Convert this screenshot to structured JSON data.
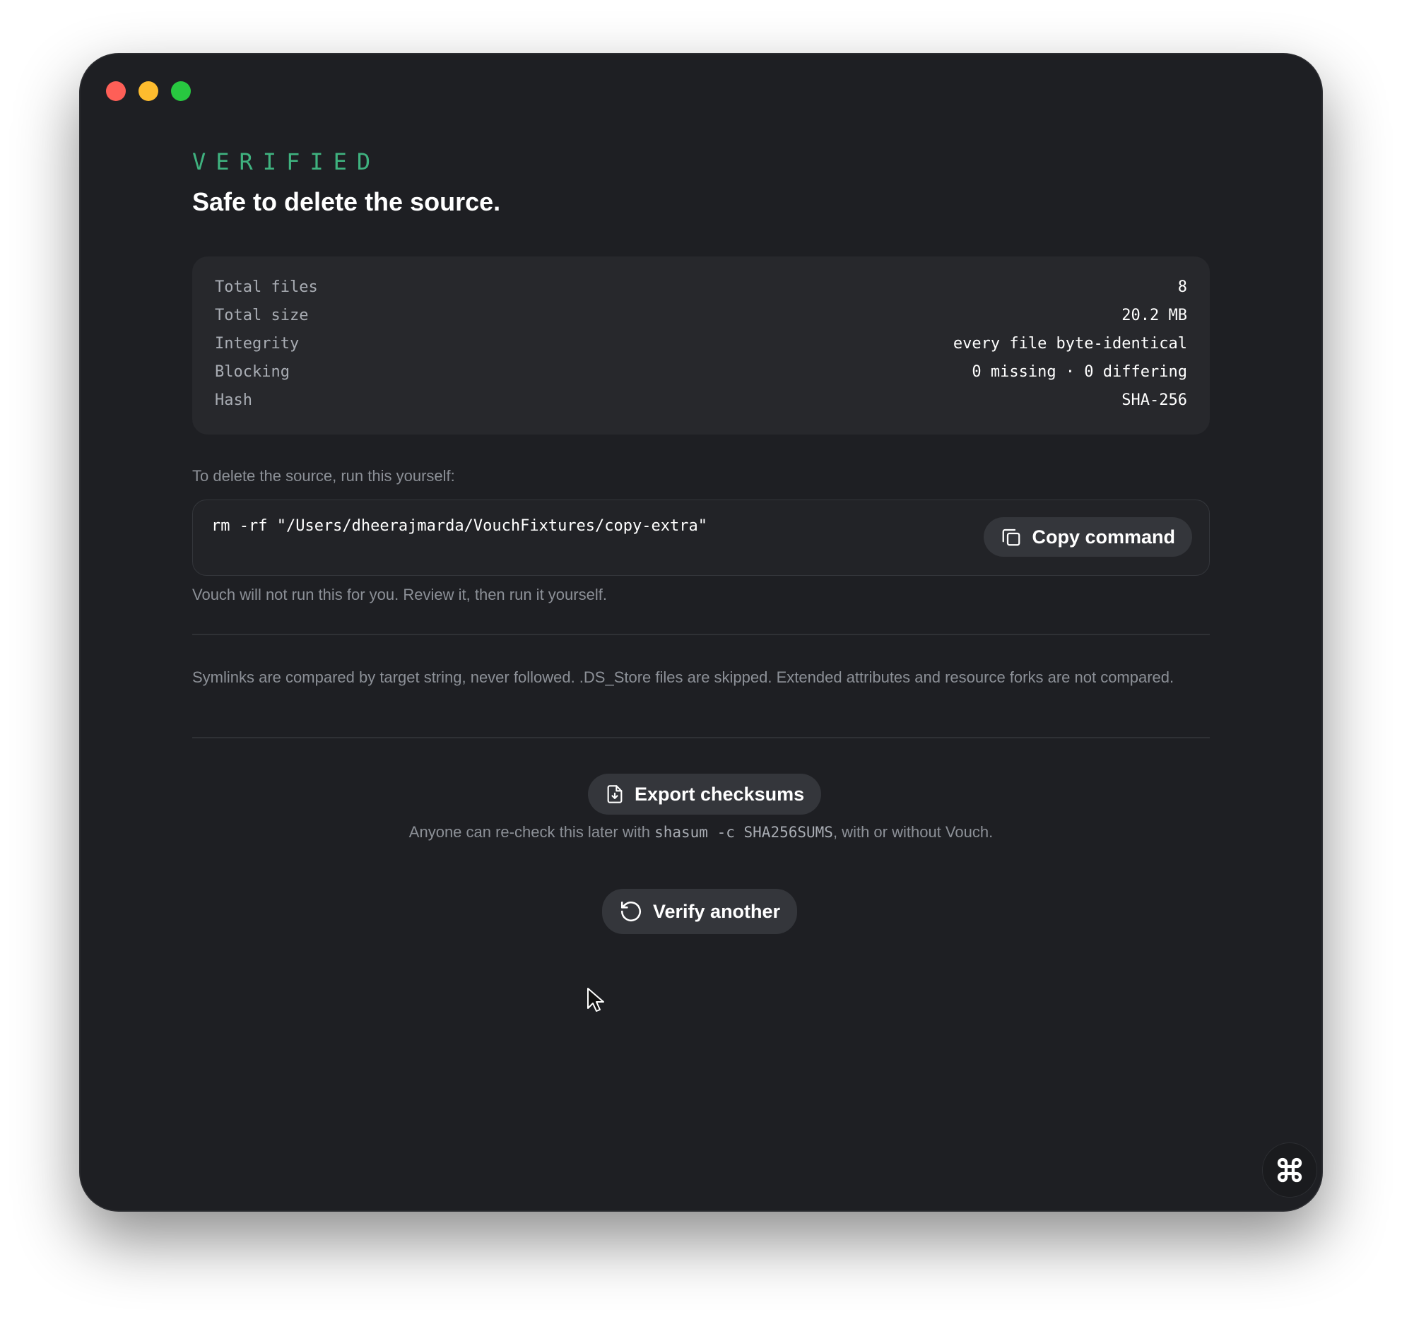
{
  "window": {
    "traffic_lights": {
      "close_color": "#fe5f57",
      "minimize_color": "#febc2e",
      "zoom_color": "#28c840"
    }
  },
  "header": {
    "status": "VERIFIED",
    "status_color": "#3fb27f",
    "title": "Safe to delete the source."
  },
  "summary": {
    "rows": [
      {
        "label": "Total files",
        "value": "8"
      },
      {
        "label": "Total size",
        "value": "20.2 MB"
      },
      {
        "label": "Integrity",
        "value": "every file byte-identical"
      },
      {
        "label": "Blocking",
        "value": "0 missing · 0 differing"
      },
      {
        "label": "Hash",
        "value": "SHA-256"
      }
    ]
  },
  "delete": {
    "hint": "To delete the source, run this yourself:",
    "command": "rm -rf \"/Users/dheerajmarda/VouchFixtures/copy-extra\"",
    "copy_label": "Copy command",
    "copy_icon": "copy-icon",
    "warning": "Vouch will not run this for you. Review it, then run it yourself."
  },
  "note": "Symlinks are compared by target string, never followed. .DS_Store files are skipped. Extended attributes and resource forks are not compared.",
  "export": {
    "label": "Export checksums",
    "icon": "file-download-icon",
    "recheck_prefix": "Anyone can re-check this later with ",
    "recheck_code": "shasum -c SHA256SUMS",
    "recheck_suffix": ", with or without Vouch."
  },
  "verify": {
    "label": "Verify another",
    "icon": "rotate-ccw-icon"
  },
  "corner": {
    "icon": "command-icon"
  }
}
